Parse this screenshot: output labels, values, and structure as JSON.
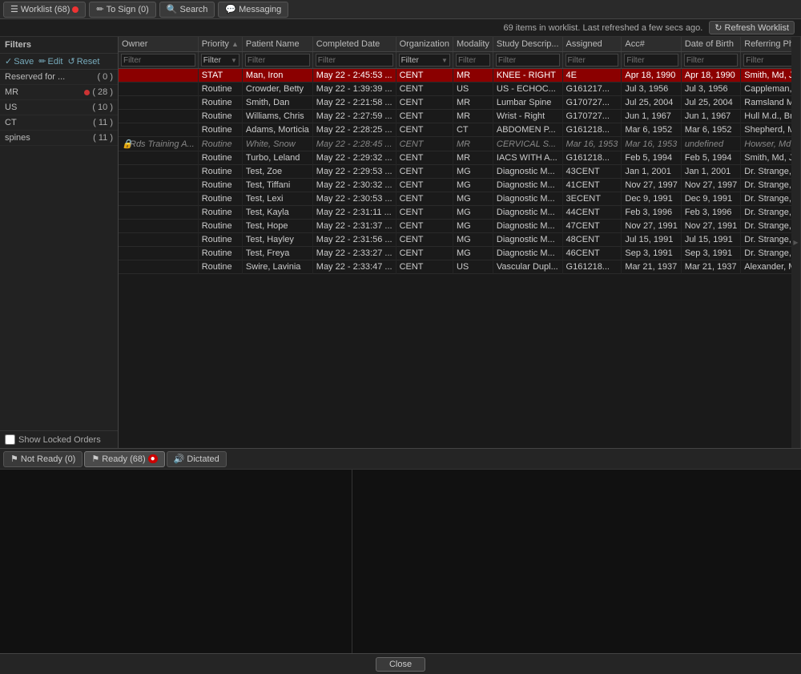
{
  "nav": {
    "worklist_label": "Worklist (68)",
    "to_sign_label": "To Sign (0)",
    "search_label": "Search",
    "messaging_label": "Messaging"
  },
  "status_bar": {
    "info": "69 items in worklist.  Last refreshed a few secs ago.",
    "refresh_label": "Refresh Worklist"
  },
  "filters": {
    "header": "Filters",
    "save_label": "Save",
    "edit_label": "Edit",
    "reset_label": "Reset",
    "items": [
      {
        "label": "Reserved for ...",
        "count": "( 0 )"
      },
      {
        "label": "MR",
        "count": "( 28 )",
        "has_dot": true
      },
      {
        "label": "US",
        "count": "( 10 )",
        "has_dot": false
      },
      {
        "label": "CT",
        "count": "( 11 )",
        "has_dot": false
      },
      {
        "label": "spines",
        "count": "( 11 )",
        "has_dot": false
      }
    ],
    "show_locked": "Show Locked Orders"
  },
  "table": {
    "columns": [
      "Owner",
      "Priority",
      "Patient Name",
      "Completed Date",
      "Organization",
      "Modality",
      "Study Descrip...",
      "Assigned",
      "Acc#",
      "Date of Birth",
      "Referring Phys..."
    ],
    "filter_placeholders": [
      "Filter",
      "Filter",
      "Filter",
      "Filter",
      "Filter",
      "Filter",
      "Filter",
      "Filter",
      "Filter",
      "Filter",
      "Filter"
    ],
    "rows": [
      {
        "owner": "",
        "priority": "STAT",
        "patient": "Man, Iron",
        "completed": "May 22 - 2:45:53 ...",
        "org": "CENT",
        "modality": "MR",
        "study": "KNEE - RIGHT",
        "assigned": "4E",
        "acc": "Apr 18, 1990",
        "dob": "Apr 18, 1990",
        "referring": "Smith, Md, John",
        "stat": true,
        "italic": false,
        "locked": false
      },
      {
        "owner": "",
        "priority": "Routine",
        "patient": "Crowder, Betty",
        "completed": "May 22 - 1:39:39 ...",
        "org": "CENT",
        "modality": "US",
        "study": "US - ECHOC...",
        "assigned": "G161217...",
        "acc": "Jul 3, 1956",
        "dob": "Jul 3, 1956",
        "referring": "Cappleman, Tr...",
        "stat": false,
        "italic": false,
        "locked": false
      },
      {
        "owner": "",
        "priority": "Routine",
        "patient": "Smith, Dan",
        "completed": "May 22 - 2:21:58 ...",
        "org": "CENT",
        "modality": "MR",
        "study": "Lumbar Spine",
        "assigned": "G170727...",
        "acc": "Jul 25, 2004",
        "dob": "Jul 25, 2004",
        "referring": "Ramsland M.d....",
        "stat": false,
        "italic": false,
        "locked": false
      },
      {
        "owner": "",
        "priority": "Routine",
        "patient": "Williams, Chris",
        "completed": "May 22 - 2:27:59 ...",
        "org": "CENT",
        "modality": "MR",
        "study": "Wrist - Right",
        "assigned": "G170727...",
        "acc": "Jun 1, 1967",
        "dob": "Jun 1, 1967",
        "referring": "Hull M.d., Bren...",
        "stat": false,
        "italic": false,
        "locked": false
      },
      {
        "owner": "",
        "priority": "Routine",
        "patient": "Adams, Morticia",
        "completed": "May 22 - 2:28:25 ...",
        "org": "CENT",
        "modality": "CT",
        "study": "ABDOMEN P...",
        "assigned": "G161218...",
        "acc": "Mar 6, 1952",
        "dob": "Mar 6, 1952",
        "referring": "Shepherd, Md....",
        "stat": false,
        "italic": false,
        "locked": false
      },
      {
        "owner": "Rds Training A...",
        "priority": "Routine",
        "patient": "White, Snow",
        "completed": "May 22 - 2:28:45 ...",
        "org": "CENT",
        "modality": "MR",
        "study": "CERVICAL S...",
        "assigned": "Mar 16, 1953",
        "acc": "Mar 16, 1953",
        "referring": "Howser, Md, D...",
        "stat": false,
        "italic": true,
        "locked": true
      },
      {
        "owner": "",
        "priority": "Routine",
        "patient": "Turbo, Leland",
        "completed": "May 22 - 2:29:32 ...",
        "org": "CENT",
        "modality": "MR",
        "study": "IACS WITH A...",
        "assigned": "G161218...",
        "acc": "Feb 5, 1994",
        "dob": "Feb 5, 1994",
        "referring": "Smith, Md, Joh...",
        "stat": false,
        "italic": false,
        "locked": false
      },
      {
        "owner": "",
        "priority": "Routine",
        "patient": "Test, Zoe",
        "completed": "May 22 - 2:29:53 ...",
        "org": "CENT",
        "modality": "MG",
        "study": "Diagnostic M...",
        "assigned": "43CENT",
        "acc": "Jan 1, 2001",
        "dob": "Jan 1, 2001",
        "referring": "Dr. Strange,...",
        "stat": false,
        "italic": false,
        "locked": false
      },
      {
        "owner": "",
        "priority": "Routine",
        "patient": "Test, Tiffani",
        "completed": "May 22 - 2:30:32 ...",
        "org": "CENT",
        "modality": "MG",
        "study": "Diagnostic M...",
        "assigned": "41CENT",
        "acc": "Nov 27, 1997",
        "dob": "Nov 27, 1997",
        "referring": "Dr. Strange,...",
        "stat": false,
        "italic": false,
        "locked": false
      },
      {
        "owner": "",
        "priority": "Routine",
        "patient": "Test, Lexi",
        "completed": "May 22 - 2:30:53 ...",
        "org": "CENT",
        "modality": "MG",
        "study": "Diagnostic M...",
        "assigned": "3ECENT",
        "acc": "Dec 9, 1991",
        "dob": "Dec 9, 1991",
        "referring": "Dr. Strange,...",
        "stat": false,
        "italic": false,
        "locked": false
      },
      {
        "owner": "",
        "priority": "Routine",
        "patient": "Test, Kayla",
        "completed": "May 22 - 2:31:11 ...",
        "org": "CENT",
        "modality": "MG",
        "study": "Diagnostic M...",
        "assigned": "44CENT",
        "acc": "Feb 3, 1996",
        "dob": "Feb 3, 1996",
        "referring": "Dr. Strange,...",
        "stat": false,
        "italic": false,
        "locked": false
      },
      {
        "owner": "",
        "priority": "Routine",
        "patient": "Test, Hope",
        "completed": "May 22 - 2:31:37 ...",
        "org": "CENT",
        "modality": "MG",
        "study": "Diagnostic M...",
        "assigned": "47CENT",
        "acc": "Nov 27, 1991",
        "dob": "Nov 27, 1991",
        "referring": "Dr. Strange,...",
        "stat": false,
        "italic": false,
        "locked": false
      },
      {
        "owner": "",
        "priority": "Routine",
        "patient": "Test, Hayley",
        "completed": "May 22 - 2:31:56 ...",
        "org": "CENT",
        "modality": "MG",
        "study": "Diagnostic M...",
        "assigned": "48CENT",
        "acc": "Jul 15, 1991",
        "dob": "Jul 15, 1991",
        "referring": "Dr. Strange,...",
        "stat": false,
        "italic": false,
        "locked": false
      },
      {
        "owner": "",
        "priority": "Routine",
        "patient": "Test, Freya",
        "completed": "May 22 - 2:33:27 ...",
        "org": "CENT",
        "modality": "MG",
        "study": "Diagnostic M...",
        "assigned": "46CENT",
        "acc": "Sep 3, 1991",
        "dob": "Sep 3, 1991",
        "referring": "Dr. Strange,...",
        "stat": false,
        "italic": false,
        "locked": false
      },
      {
        "owner": "",
        "priority": "Routine",
        "patient": "Swire, Lavinia",
        "completed": "May 22 - 2:33:47 ...",
        "org": "CENT",
        "modality": "US",
        "study": "Vascular Dupl...",
        "assigned": "G161218...",
        "acc": "Mar 21, 1937",
        "dob": "Mar 21, 1937",
        "referring": "Alexander, M.d....",
        "stat": false,
        "italic": false,
        "locked": false
      }
    ]
  },
  "bottom_tabs": {
    "not_ready_label": "Not Ready (0)",
    "ready_label": "Ready (68)",
    "dictated_label": "Dictated"
  },
  "footer": {
    "close_label": "Close"
  }
}
